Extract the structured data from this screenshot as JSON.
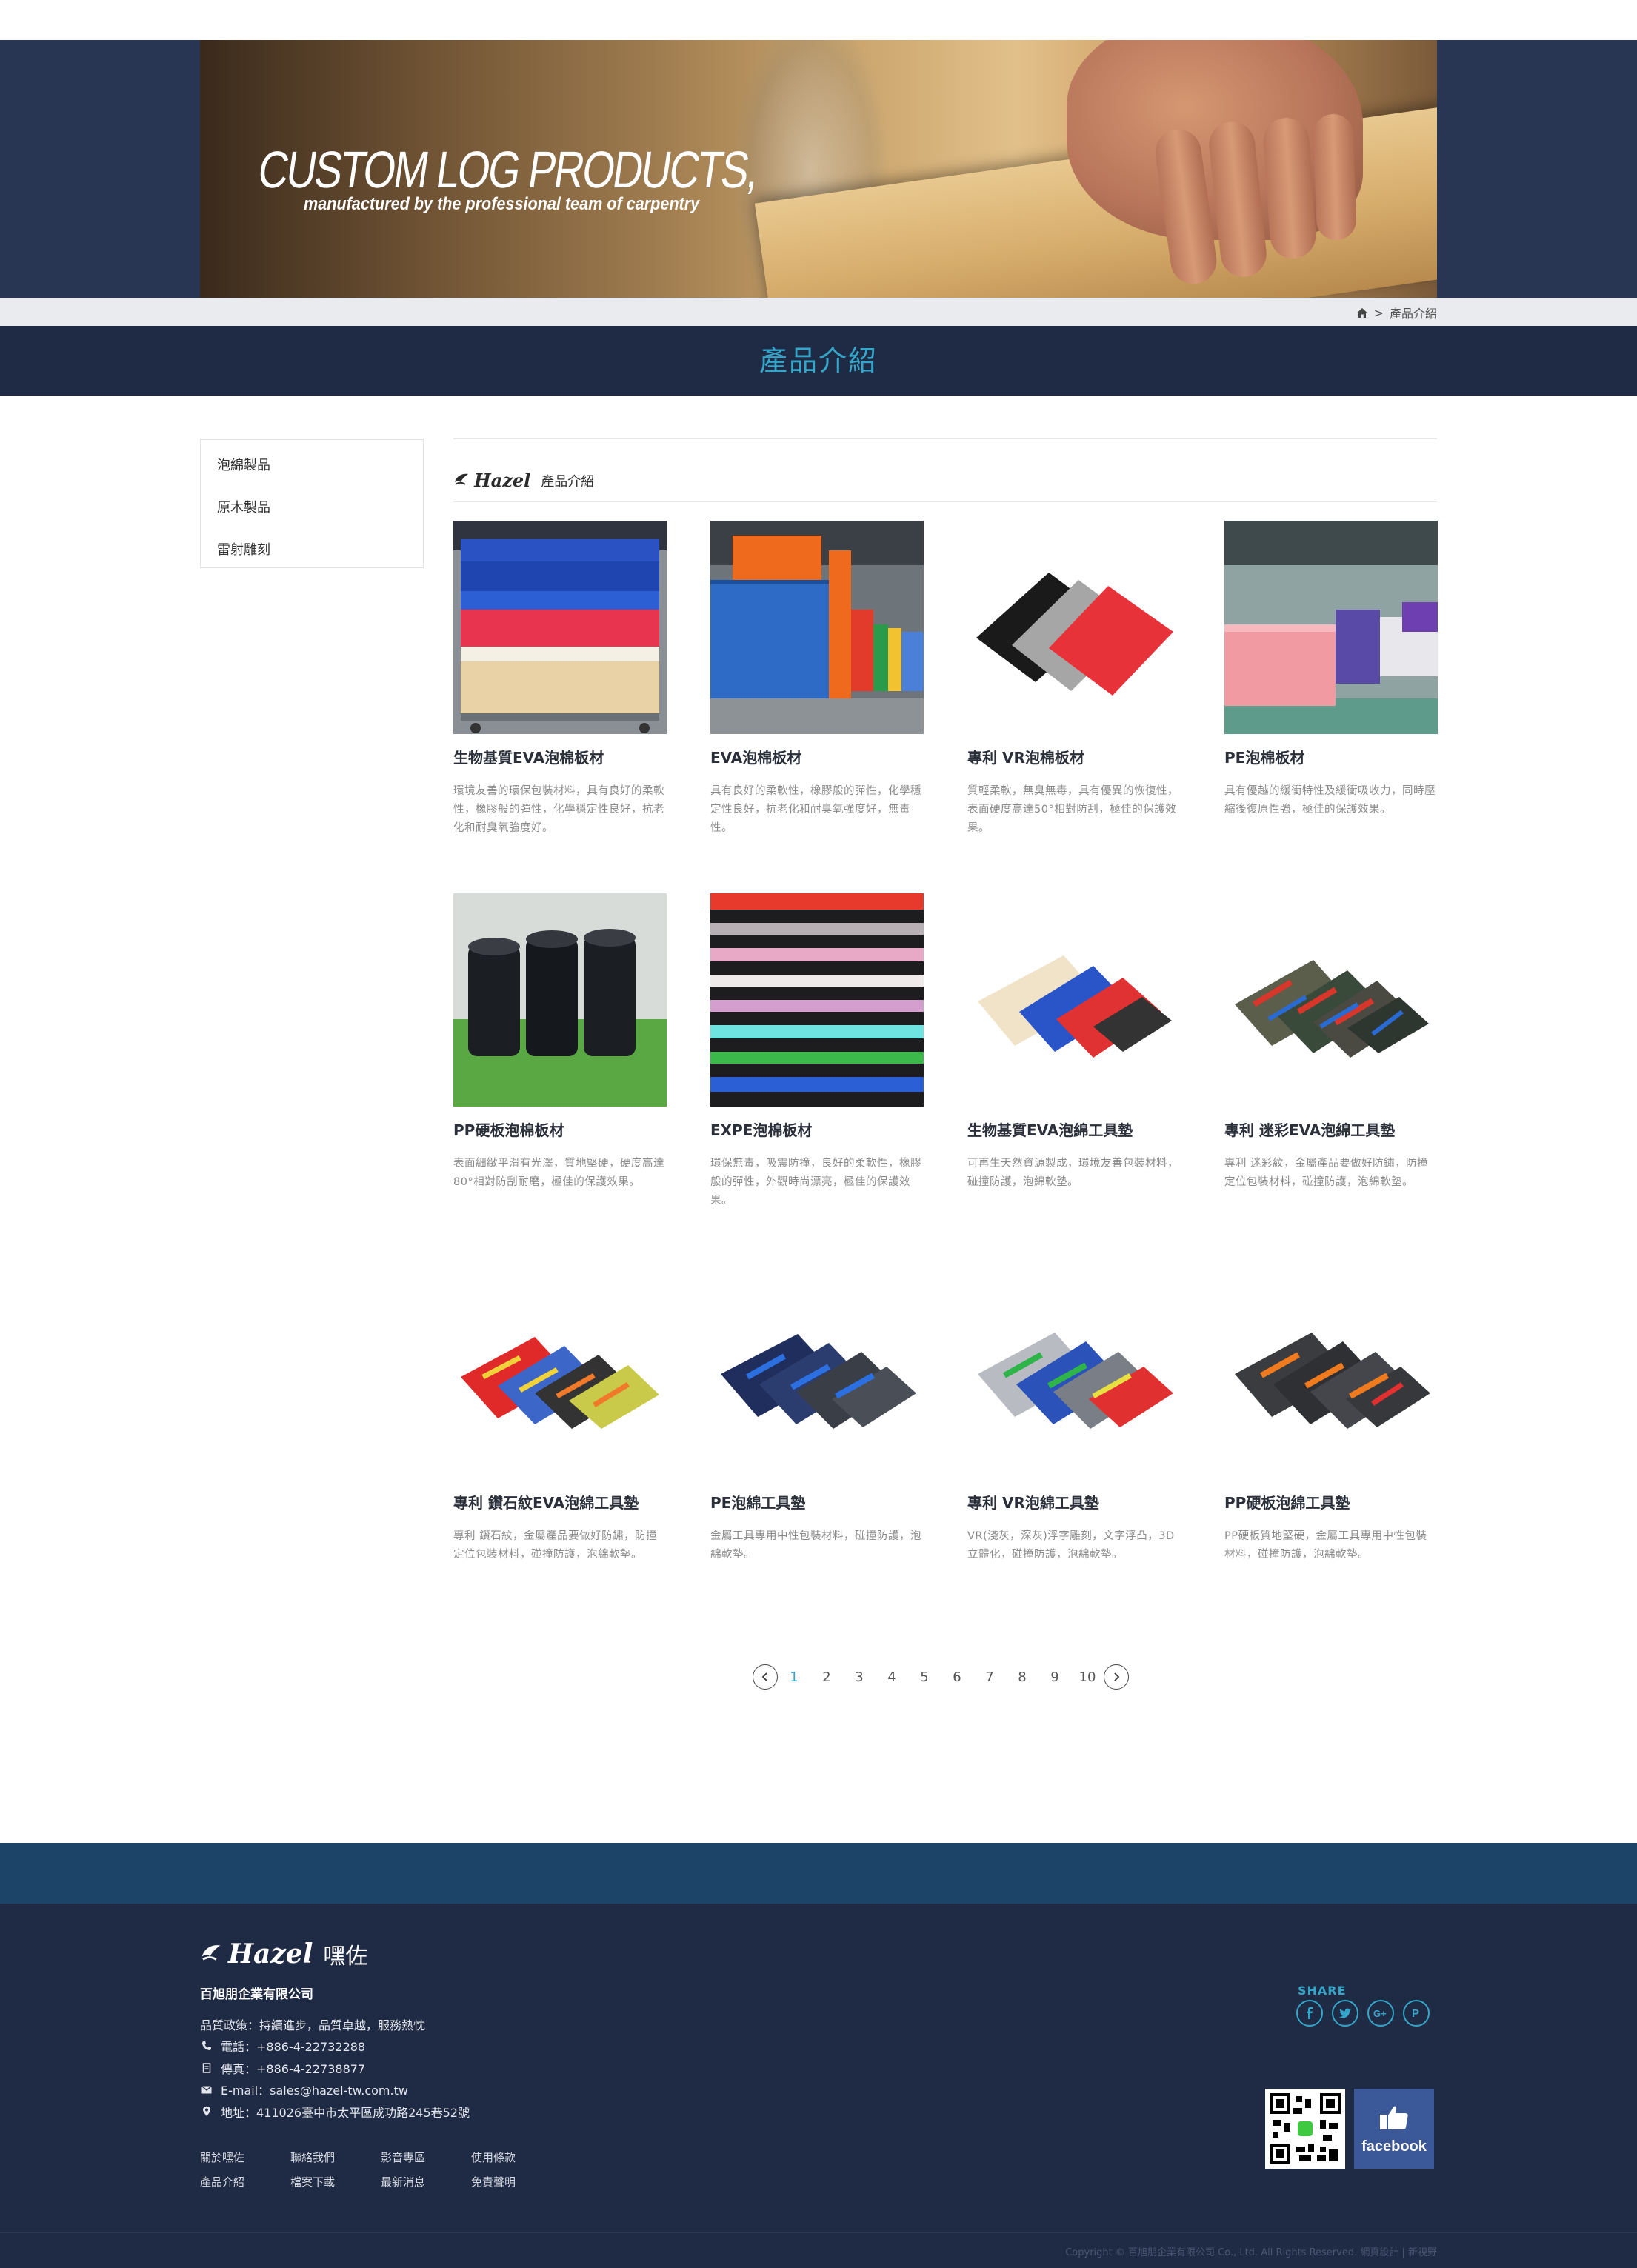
{
  "hero": {
    "title": "CUSTOM LOG PRODUCTS,",
    "subtitle": "manufactured by the professional team of carpentry"
  },
  "breadcrumb": {
    "separator": ">",
    "current": "產品介紹"
  },
  "page_title": "產品介紹",
  "sidebar": {
    "items": [
      {
        "label": "泡綿製品"
      },
      {
        "label": "原木製品"
      },
      {
        "label": "雷射雕刻"
      }
    ]
  },
  "content": {
    "brand": "Hazel",
    "title": "產品介紹"
  },
  "products": [
    {
      "title": "生物基質EVA泡棉板材",
      "desc": "環境友善的環保包裝材料，具有良好的柔軟性，橡膠般的彈性，化學穩定性良好，抗老化和耐臭氧強度好。"
    },
    {
      "title": "EVA泡棉板材",
      "desc": "具有良好的柔軟性，橡膠般的彈性，化學穩定性良好，抗老化和耐臭氧強度好，無毒性。"
    },
    {
      "title": "專利 VR泡棉板材",
      "desc": "質輕柔軟，無臭無毒，具有優異的恢復性，表面硬度高達50°相對防刮，極佳的保護效果。"
    },
    {
      "title": "PE泡棉板材",
      "desc": "具有優越的緩衝特性及緩衝吸收力，同時壓縮後復原性強，極佳的保護效果。"
    },
    {
      "title": "PP硬板泡棉板材",
      "desc": "表面細緻平滑有光澤，質地堅硬，硬度高達80°相對防刮耐磨，極佳的保護效果。"
    },
    {
      "title": "EXPE泡棉板材",
      "desc": "環保無毒，吸震防撞，良好的柔軟性，橡膠般的彈性，外觀時尚漂亮，極佳的保護效果。"
    },
    {
      "title": "生物基質EVA泡綿工具墊",
      "desc": "可再生天然資源製成，環境友善包裝材料，碰撞防護，泡綿軟墊。"
    },
    {
      "title": "專利 迷彩EVA泡綿工具墊",
      "desc": "專利 迷彩紋，金屬產品要做好防鏽，防撞定位包裝材料，碰撞防護，泡綿軟墊。"
    },
    {
      "title": "專利 鑽石紋EVA泡綿工具墊",
      "desc": "專利 鑽石紋，金屬產品要做好防鏽，防撞定位包裝材料，碰撞防護，泡綿軟墊。"
    },
    {
      "title": "PE泡綿工具墊",
      "desc": "金屬工具專用中性包裝材料，碰撞防護，泡綿軟墊。"
    },
    {
      "title": "專利 VR泡綿工具墊",
      "desc": "VR(淺灰，深灰)浮字雕刻，文字浮凸，3D立體化，碰撞防護，泡綿軟墊。"
    },
    {
      "title": "PP硬板泡綿工具墊",
      "desc": "PP硬板質地堅硬，金屬工具專用中性包裝材料，碰撞防護，泡綿軟墊。"
    }
  ],
  "pagination": {
    "pages": [
      "1",
      "2",
      "3",
      "4",
      "5",
      "6",
      "7",
      "8",
      "9",
      "10"
    ],
    "current": "1"
  },
  "footer": {
    "brand": "Hazel",
    "brand_cn": "嘿佐",
    "company": "百旭朋企業有限公司",
    "policy": "品質政策：持續進步，品質卓越，服務熱忱",
    "phone": "電話：+886-4-22732288",
    "fax": "傳真：+886-4-22738877",
    "email": "E-mail：sales@hazel-tw.com.tw",
    "address": "地址：411026臺中市太平區成功路245巷52號",
    "links": [
      "關於嘿佐",
      "聯絡我們",
      "影音專區",
      "使用條款",
      "產品介紹",
      "檔案下載",
      "最新消息",
      "免責聲明"
    ],
    "share_label": "SHARE",
    "facebook_label": "facebook",
    "copyright": "Copyright © 百旭朋企業有限公司 Co., Ltd. All Rights Reserved. 網頁設計 | 新視野"
  },
  "colors": {
    "accent": "#35a6c9",
    "navy": "#1f2a44",
    "footer_band": "#1b4468"
  }
}
